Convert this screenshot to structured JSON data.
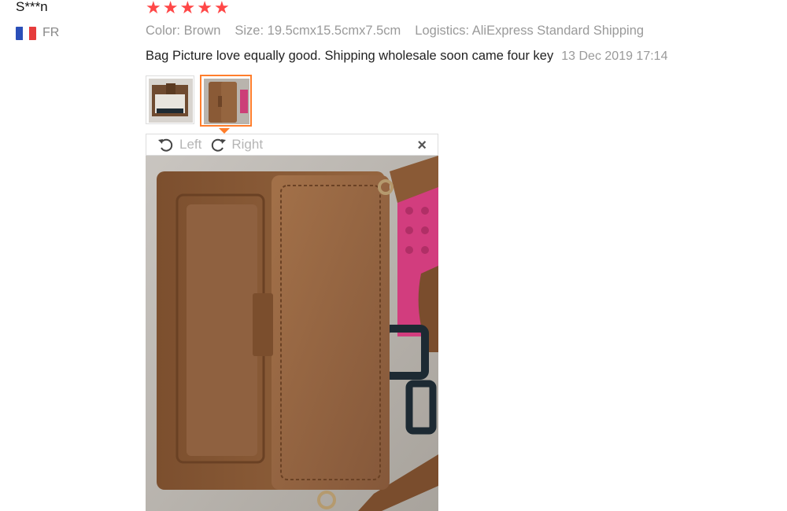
{
  "reviewer": {
    "name": "S***n",
    "country_code": "FR",
    "flag_colors": [
      "#2a4fb8",
      "#ffffff",
      "#e63c3c"
    ]
  },
  "review": {
    "rating": 5,
    "stars": [
      "★",
      "★",
      "★",
      "★",
      "★"
    ],
    "color": "Color: Brown",
    "size": "Size: 19.5cmx15.5cmx7.5cm",
    "logistics": "Logistics: AliExpress Standard Shipping",
    "text": "Bag Picture love equally good. Shipping wholesale soon came four key",
    "date": "13 Dec 2019 17:14"
  },
  "viewer": {
    "rotate_left_label": "Left",
    "rotate_right_label": "Right",
    "close_glyph": "×"
  },
  "colors": {
    "accent": "#ff7d2b",
    "star": "#ff4747",
    "muted": "#9a9a9a"
  }
}
